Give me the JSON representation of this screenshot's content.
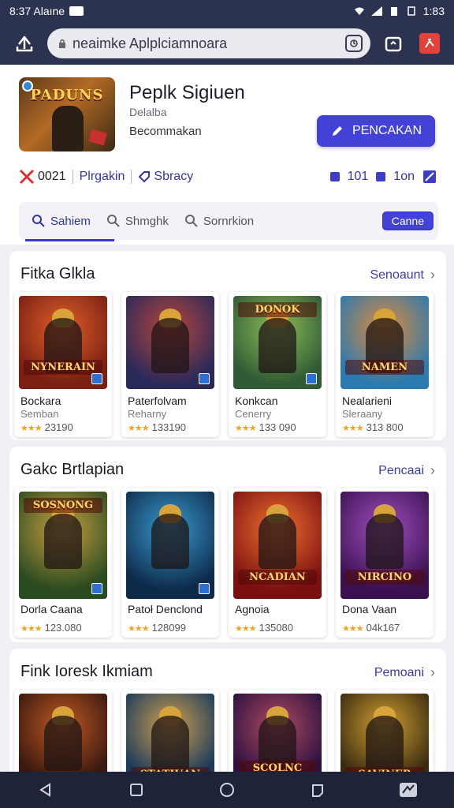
{
  "status": {
    "time_label": "8:37 Alaıne",
    "battery_label": "1:83"
  },
  "browser": {
    "url": "neaimke Aplplciamnoara"
  },
  "app": {
    "title": "Peplk Sigiuen",
    "subtitle": "Delalba",
    "developer": "Becommakan",
    "install_label": "PENCAKAN",
    "thumb_text": "PADUNS",
    "meta": {
      "rating_label": "0021",
      "item2_label": "Plrgakin",
      "item3_label": "Sbracy",
      "right1_label": "101",
      "right2_label": "1on"
    }
  },
  "tabs": [
    {
      "label": "Sahiem"
    },
    {
      "label": "Shmghk"
    },
    {
      "label": "Sornrkion"
    }
  ],
  "tab_action_label": "Canne",
  "sections": [
    {
      "title": "Fitka Glkla",
      "link": "Senoaunt",
      "cards": [
        {
          "name": "Bockara",
          "sub": "Semban",
          "rating": "23190",
          "art": "NYNERAIN",
          "c1": "#7a1f12",
          "c2": "#e0602a"
        },
        {
          "name": "Paterfolvam",
          "sub": "Reharny",
          "rating": "133190",
          "art": "",
          "c1": "#2a2a5a",
          "c2": "#b8453a"
        },
        {
          "name": "Konkcan",
          "sub": "Cenerry",
          "rating": "133 090",
          "art": "DONOK",
          "c1": "#2f5a34",
          "c2": "#8fbf5a"
        },
        {
          "name": "Nealarieni",
          "sub": "Sleraany",
          "rating": "313 800",
          "art": "NAMEN",
          "c1": "#2a7ab0",
          "c2": "#e08a3a"
        }
      ]
    },
    {
      "title": "Gakc Brtlapian",
      "link": "Pencaai",
      "cards": [
        {
          "name": "Dorla Caana",
          "sub": "",
          "rating": "123.080",
          "art": "SOSNONG",
          "c1": "#2a4a20",
          "c2": "#c8a040"
        },
        {
          "name": "Patoł Denclond",
          "sub": "",
          "rating": "128099",
          "art": "",
          "c1": "#0d2a4a",
          "c2": "#3a9ad0"
        },
        {
          "name": "Agnoia",
          "sub": "",
          "rating": "135080",
          "art": "NCADIAN",
          "c1": "#7a1010",
          "c2": "#f07030"
        },
        {
          "name": "Dona Vaan",
          "sub": "",
          "rating": "04k167",
          "art": "NIRCINO",
          "c1": "#3a1050",
          "c2": "#a050c0"
        }
      ]
    },
    {
      "title": "Fink Ioresk Ikmiam",
      "link": "Pemoani",
      "cards": [
        {
          "name": "",
          "sub": "",
          "rating": "",
          "art": "",
          "c1": "#3a1810",
          "c2": "#c05a20"
        },
        {
          "name": "",
          "sub": "",
          "rating": "",
          "art": "STATIUAN",
          "c1": "#1a3a5a",
          "c2": "#d0a050"
        },
        {
          "name": "",
          "sub": "",
          "rating": "",
          "art": "SCOLNC",
          "c1": "#2a1040",
          "c2": "#b04a60"
        },
        {
          "name": "",
          "sub": "",
          "rating": "",
          "art": "SAVINER",
          "c1": "#3a2a10",
          "c2": "#d0a030"
        }
      ]
    }
  ],
  "colors": {
    "accent": "#4242d8",
    "header_bg": "#2c3350",
    "star": "#f0a320"
  }
}
